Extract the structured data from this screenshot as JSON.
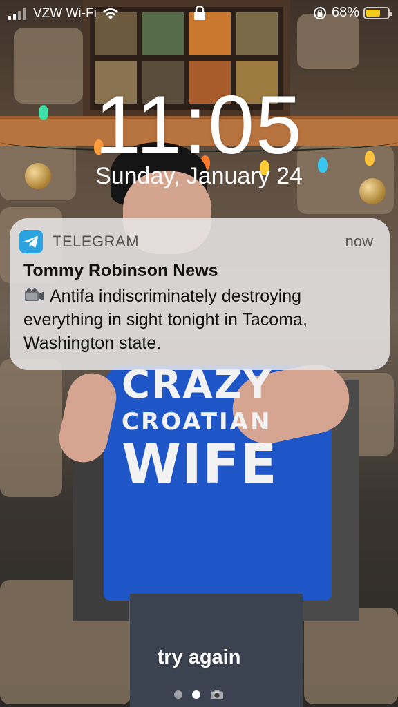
{
  "status_bar": {
    "carrier": "VZW Wi-Fi",
    "battery_percent": "68%",
    "battery_level": 0.68,
    "battery_color": "#f6cc1b"
  },
  "lock_screen": {
    "time": "11:05",
    "date": "Sunday, January 24"
  },
  "notification": {
    "app_name": "TELEGRAM",
    "app_icon": "telegram-icon",
    "app_color": "#2aa3e0",
    "time": "now",
    "title": "Tommy Robinson News",
    "body_icon": "video-camera-icon",
    "body": "Antifa indiscriminately destroying everything in sight tonight in Tacoma, Washington state."
  },
  "wallpaper": {
    "shirt_lines": [
      "CRAZY",
      "CROATIAN",
      "WIFE"
    ]
  },
  "bottom": {
    "hint": "try again",
    "pages": 2,
    "active_page": 2
  }
}
